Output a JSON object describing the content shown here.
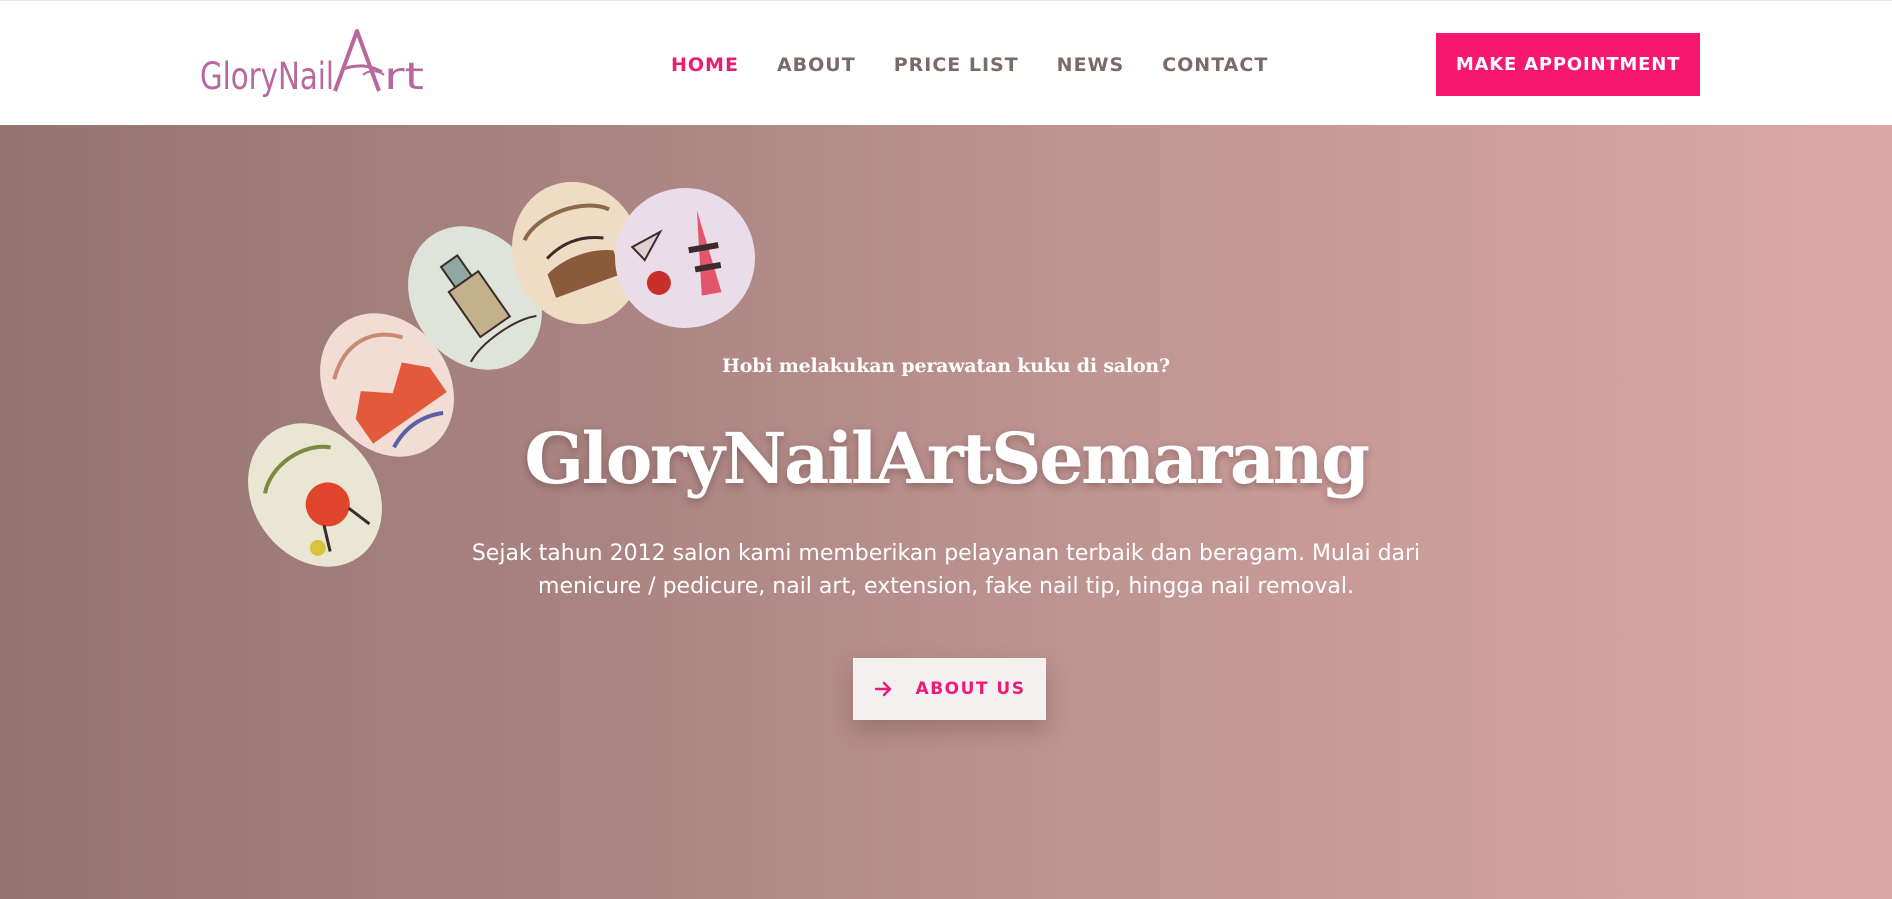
{
  "logo": {
    "text": "GloryNailArt",
    "icon": "glorynailart-logo"
  },
  "nav": {
    "items": [
      {
        "label": "HOME",
        "active": true
      },
      {
        "label": "ABOUT",
        "active": false
      },
      {
        "label": "PRICE LIST",
        "active": false
      },
      {
        "label": "NEWS",
        "active": false
      },
      {
        "label": "CONTACT",
        "active": false
      }
    ]
  },
  "header": {
    "cta_label": "MAKE APPOINTMENT"
  },
  "hero": {
    "kicker": "Hobi melakukan perawatan kuku di salon?",
    "title": "GloryNailArtSemarang",
    "description": "Sejak tahun 2012 salon kami memberikan pelayanan terbaik dan beragam. Mulai dari menicure / pedicure, nail art, extension, fake nail tip, hingga nail removal.",
    "button_label": "ABOUT US",
    "button_icon": "arrow-right-icon",
    "image": "painted-nail-tips-image"
  },
  "colors": {
    "accent": "#ec1b75",
    "cta_bg": "#f6176f",
    "nav_text": "#7a6a68",
    "hero_gradient_start": "#937471",
    "hero_gradient_end": "#dca8a5"
  }
}
